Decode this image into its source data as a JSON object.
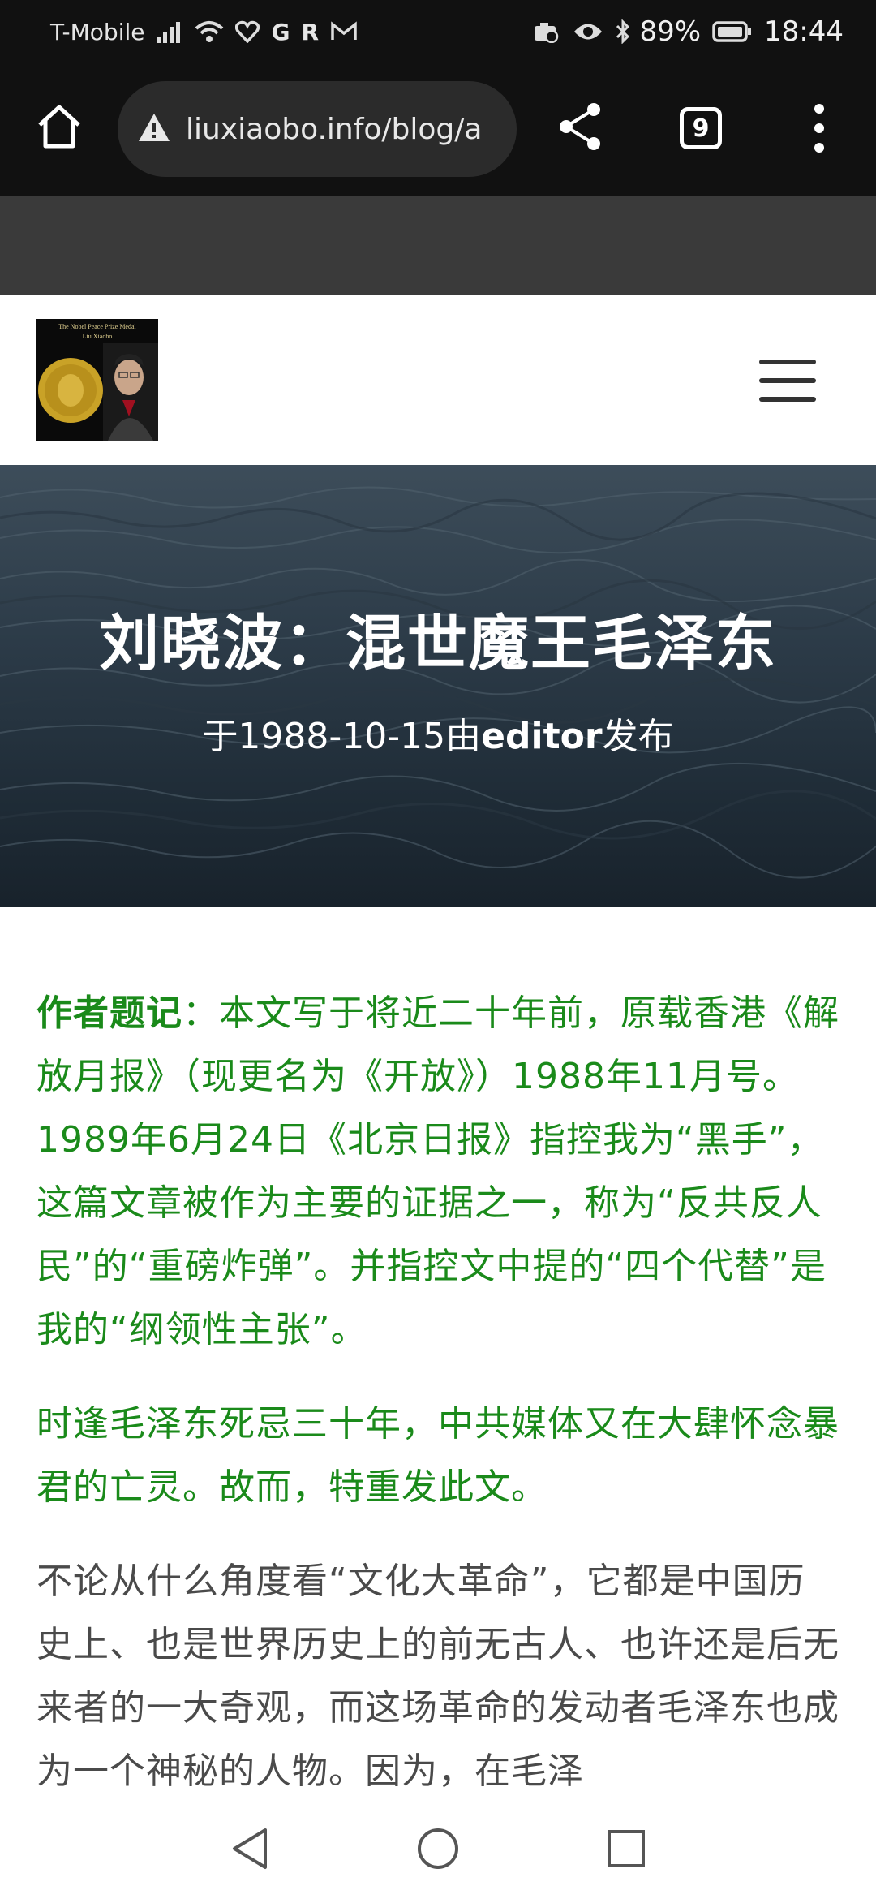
{
  "status_bar": {
    "carrier": "T-Mobile",
    "battery": "89%",
    "time": "18:44",
    "icons": [
      "signal-icon",
      "wifi-icon",
      "heart-icon",
      "g-icon",
      "r-icon",
      "mail-icon",
      "camera-icon",
      "eye-icon",
      "bluetooth-icon",
      "battery-icon"
    ]
  },
  "browser": {
    "url": "liuxiaobo.info/blog/a",
    "tab_count": "9",
    "icons": [
      "home-icon",
      "warning-icon",
      "share-icon",
      "tabs-icon",
      "more-icon"
    ]
  },
  "site": {
    "logo_top_text": "The Nobel Peace Prize Medal",
    "logo_name": "Liu Xiaobo",
    "logo_side_text": "Nobel Peace Prize Medal"
  },
  "hero": {
    "title": "刘晓波：混世魔王毛泽东",
    "meta_prefix": "于1988-10-15由",
    "meta_author": "editor",
    "meta_suffix": "发布"
  },
  "article": {
    "note_label": "作者题记",
    "note_text": "：本文写于将近二十年前，原载香港《解放月报》（现更名为《开放》）1988年11月号。1989年6月24日《北京日报》指控我为“黑手”，这篇文章被作为主要的证据之一，称为“反共反人民”的“重磅炸弹”。并指控文中提的“四个代替”是我的“纲领性主张”。",
    "para2": "时逢毛泽东死忌三十年，中共媒体又在大肆怀念暴君的亡灵。故而，特重发此文。",
    "para3": "不论从什么角度看“文化大革命”，它都是中国历史上、也是世界历史上的前无古人、也许还是后无来者的一大奇观，而这场革命的发动者毛泽东也成为一个神秘的人物。因为，在毛泽"
  },
  "nav": {
    "icons": [
      "back-icon",
      "home-circle-icon",
      "recents-icon"
    ]
  }
}
